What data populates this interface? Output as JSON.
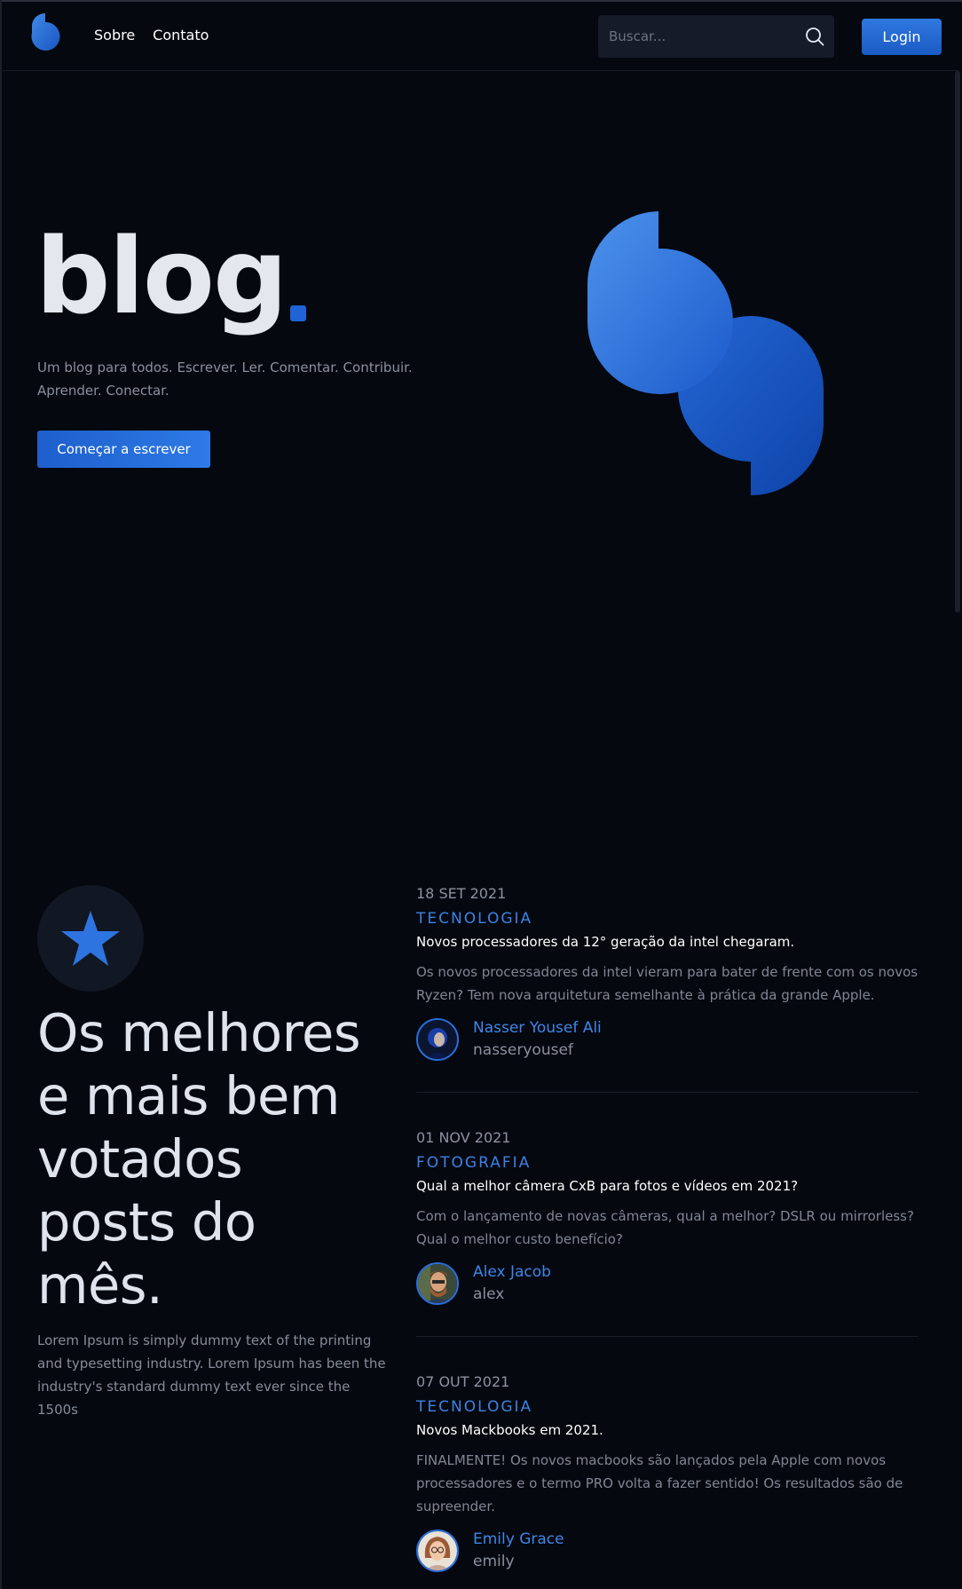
{
  "nav": {
    "links": [
      "Sobre",
      "Contato"
    ],
    "search_placeholder": "Buscar...",
    "login_label": "Login"
  },
  "hero": {
    "title": "blog",
    "subtitle": "Um blog para todos. Escrever. Ler. Comentar. Contribuir. Aprender. Conectar.",
    "cta_label": "Começar a escrever"
  },
  "featured": {
    "title": "Os melhores e mais bem votados posts do mês.",
    "description": "Lorem Ipsum is simply dummy text of the printing and typesetting industry. Lorem Ipsum has been the industry's standard dummy text ever since the 1500s"
  },
  "posts": [
    {
      "date": "18 SET 2021",
      "category": "TECNOLOGIA",
      "title": "Novos processadores da 12° geração da intel chegaram.",
      "excerpt": "Os novos processadores da intel vieram para bater de frente com os novos Ryzen? Tem nova arquitetura semelhante à prática da grande Apple.",
      "author_name": "Nasser Yousef Ali",
      "author_handle": "nasseryousef"
    },
    {
      "date": "01 NOV 2021",
      "category": "FOTOGRAFIA",
      "title": "Qual a melhor câmera CxB para fotos e vídeos em 2021?",
      "excerpt": "Com o lançamento de novas câmeras, qual a melhor? DSLR ou mirrorless? Qual o melhor custo benefício?",
      "author_name": "Alex Jacob",
      "author_handle": "alex"
    },
    {
      "date": "07 OUT 2021",
      "category": "TECNOLOGIA",
      "title": "Novos Mackbooks em 2021.",
      "excerpt": "FINALMENTE! Os novos macbooks são lançados pela Apple com novos processadores e o termo PRO volta a fazer sentido! Os resultados são de supreender.",
      "author_name": "Emily Grace",
      "author_handle": "emily"
    }
  ],
  "colors": {
    "background": "#05080f",
    "accent": "#2f78e0",
    "category": "#3b82e6",
    "muted_text": "#868c9a"
  },
  "icons": {
    "logo": "blue-drop-logo",
    "search": "search-icon",
    "featured": "star-icon"
  }
}
